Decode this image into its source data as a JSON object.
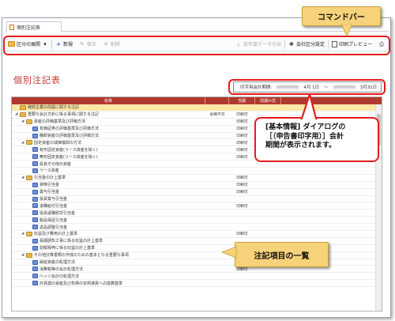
{
  "tab": {
    "label": "個別注記表"
  },
  "toolbar": {
    "partition_label": "区分の展開",
    "new_label": "新規",
    "edit_label": "修正",
    "delete_label": "削除",
    "prev_year_label": "前年度データ引出",
    "company_settings_label": "会社区分設定",
    "print_preview_label": "印刷プレビュー"
  },
  "page": {
    "title": "個別注記表",
    "period_label": "印字用会計期間:",
    "period_from": "4月 1日",
    "period_sep": "〜",
    "period_to": "3月31日"
  },
  "grid": {
    "headers": [
      "名称",
      "",
      "当期",
      "前期/n式"
    ],
    "rows": [
      {
        "indent": 0,
        "type": "folder",
        "toggle": "",
        "name": "継続企業の前提に関する注記",
        "c1": "",
        "c2": "",
        "c3": "",
        "selected": true
      },
      {
        "indent": 0,
        "type": "folder",
        "toggle": "◢",
        "name": "重要な会計方針に係る事項に関する注記",
        "c1": "省略不可",
        "c2": "印刷可",
        "c3": "",
        "selected": false
      },
      {
        "indent": 1,
        "type": "folder",
        "toggle": "◢",
        "name": "資産の評価基準及び評価方法",
        "c1": "",
        "c2": "印刷可",
        "c3": "",
        "selected": false
      },
      {
        "indent": 2,
        "type": "item",
        "toggle": "",
        "name": "有価証券の評価基準及び評価方法",
        "c1": "",
        "c2": "印刷可",
        "c3": "",
        "selected": false
      },
      {
        "indent": 2,
        "type": "item",
        "toggle": "",
        "name": "棚卸資産の評価基準及び評価方法",
        "c1": "",
        "c2": "印刷可",
        "c3": "",
        "selected": false
      },
      {
        "indent": 1,
        "type": "folder",
        "toggle": "◢",
        "name": "固定資産の減価償却の方法",
        "c1": "",
        "c2": "印刷可",
        "c3": "",
        "selected": false
      },
      {
        "indent": 2,
        "type": "item",
        "toggle": "",
        "name": "有形固定資産(リース資産を除く)",
        "c1": "",
        "c2": "印刷可",
        "c3": "",
        "selected": false
      },
      {
        "indent": 2,
        "type": "item",
        "toggle": "",
        "name": "無形固定資産(リース資産を除く)",
        "c1": "",
        "c2": "印刷可",
        "c3": "",
        "selected": false
      },
      {
        "indent": 2,
        "type": "item",
        "toggle": "",
        "name": "投資その他の資産",
        "c1": "",
        "c2": "",
        "c3": "",
        "selected": false
      },
      {
        "indent": 2,
        "type": "item",
        "toggle": "",
        "name": "リース資産",
        "c1": "",
        "c2": "",
        "c3": "",
        "selected": false
      },
      {
        "indent": 1,
        "type": "folder",
        "toggle": "◢",
        "name": "引当金の計上基準",
        "c1": "",
        "c2": "印刷可",
        "c3": "",
        "selected": false
      },
      {
        "indent": 2,
        "type": "item",
        "toggle": "",
        "name": "貸倒引当金",
        "c1": "",
        "c2": "印刷可",
        "c3": "",
        "selected": false
      },
      {
        "indent": 2,
        "type": "item",
        "toggle": "",
        "name": "賞与引当金",
        "c1": "",
        "c2": "印刷可",
        "c3": "",
        "selected": false
      },
      {
        "indent": 2,
        "type": "item",
        "toggle": "",
        "name": "役員賞与引当金",
        "c1": "",
        "c2": "",
        "c3": "",
        "selected": false
      },
      {
        "indent": 2,
        "type": "item",
        "toggle": "",
        "name": "退職給付引当金",
        "c1": "",
        "c2": "印刷可",
        "c3": "",
        "selected": false
      },
      {
        "indent": 2,
        "type": "item",
        "toggle": "",
        "name": "役員退職慰労引当金",
        "c1": "",
        "c2": "",
        "c3": "",
        "selected": false
      },
      {
        "indent": 2,
        "type": "item",
        "toggle": "",
        "name": "製品保証引当金",
        "c1": "",
        "c2": "",
        "c3": "",
        "selected": false
      },
      {
        "indent": 2,
        "type": "item",
        "toggle": "",
        "name": "返品調整引当金",
        "c1": "",
        "c2": "",
        "c3": "",
        "selected": false
      },
      {
        "indent": 1,
        "type": "folder",
        "toggle": "◢",
        "name": "収益及び費用の計上基準",
        "c1": "",
        "c2": "印刷可",
        "c3": "",
        "selected": false
      },
      {
        "indent": 2,
        "type": "item",
        "toggle": "",
        "name": "長期請負工事に係る収益の計上基準",
        "c1": "",
        "c2": "",
        "c3": "",
        "selected": false
      },
      {
        "indent": 2,
        "type": "item",
        "toggle": "",
        "name": "割賦販売に係る収益の計上基準",
        "c1": "",
        "c2": "",
        "c3": "",
        "selected": false
      },
      {
        "indent": 1,
        "type": "folder",
        "toggle": "◢",
        "name": "その他計算書類の作成のための基本となる重要な事項",
        "c1": "",
        "c2": "印刷可",
        "c3": "",
        "selected": false
      },
      {
        "indent": 2,
        "type": "item",
        "toggle": "",
        "name": "繰延資産の処理方法",
        "c1": "",
        "c2": "",
        "c3": "",
        "selected": false
      },
      {
        "indent": 2,
        "type": "item",
        "toggle": "",
        "name": "消費税等の会計処理方法",
        "c1": "",
        "c2": "印刷可",
        "c3": "",
        "selected": false
      },
      {
        "indent": 2,
        "type": "item",
        "toggle": "",
        "name": "ヘッジ会計の処理方法",
        "c1": "",
        "c2": "",
        "c3": "",
        "selected": false
      },
      {
        "indent": 2,
        "type": "item",
        "toggle": "",
        "name": "外貨建の資産及び負債の本邦通貨への換算基準",
        "c1": "",
        "c2": "",
        "c3": "",
        "selected": false
      }
    ]
  },
  "callouts": {
    "command_bar": "コマンドバー",
    "info_line1": "[基本情報] ダイアログの",
    "info_line2": "［（申告書印字用）］会計",
    "info_line3": "期間が表示されます。",
    "list": "注記項目の一覧"
  },
  "colors": {
    "accent_red": "#e51c1c",
    "header_red": "#b03a2e",
    "callout_yellow": "#f6d27a",
    "selected_row": "#fde8a8"
  }
}
